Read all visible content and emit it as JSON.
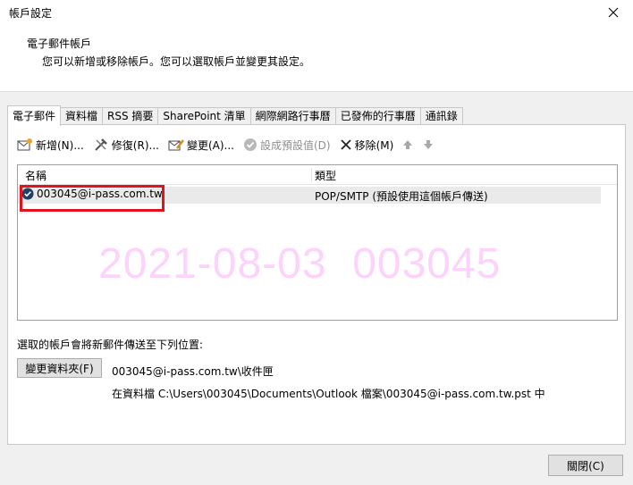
{
  "window": {
    "title": "帳戶設定"
  },
  "header": {
    "title": "電子郵件帳戶",
    "subtitle": "您可以新增或移除帳戶。您可以選取帳戶並變更其設定。"
  },
  "tabs": [
    {
      "label": "電子郵件"
    },
    {
      "label": "資料檔"
    },
    {
      "label": "RSS 摘要"
    },
    {
      "label": "SharePoint 清單"
    },
    {
      "label": "網際網路行事曆"
    },
    {
      "label": "已發佈的行事曆"
    },
    {
      "label": "通訊錄"
    }
  ],
  "toolbar": {
    "new_label": "新增(N)...",
    "repair_label": "修復(R)...",
    "change_label": "變更(A)...",
    "default_label": "設成預設值(D)",
    "remove_label": "移除(M)"
  },
  "list": {
    "col_name": "名稱",
    "col_type": "類型",
    "rows": [
      {
        "name": "003045@i-pass.com.tw",
        "type": "POP/SMTP (預設使用這個帳戶傳送)"
      }
    ]
  },
  "watermark": "2021-08-03  003045",
  "delivery": {
    "label": "選取的帳戶會將新郵件傳送至下列位置:",
    "change_folder_label": "變更資料夾(F)",
    "path": "003045@i-pass.com.tw\\收件匣",
    "file": "在資料檔 C:\\Users\\003045\\Documents\\Outlook 檔案\\003045@i-pass.com.tw.pst 中"
  },
  "footer": {
    "close_label": "關閉(C)"
  },
  "colors": {
    "highlight_box": "#e0141e",
    "watermark": "#fcd3fb"
  }
}
